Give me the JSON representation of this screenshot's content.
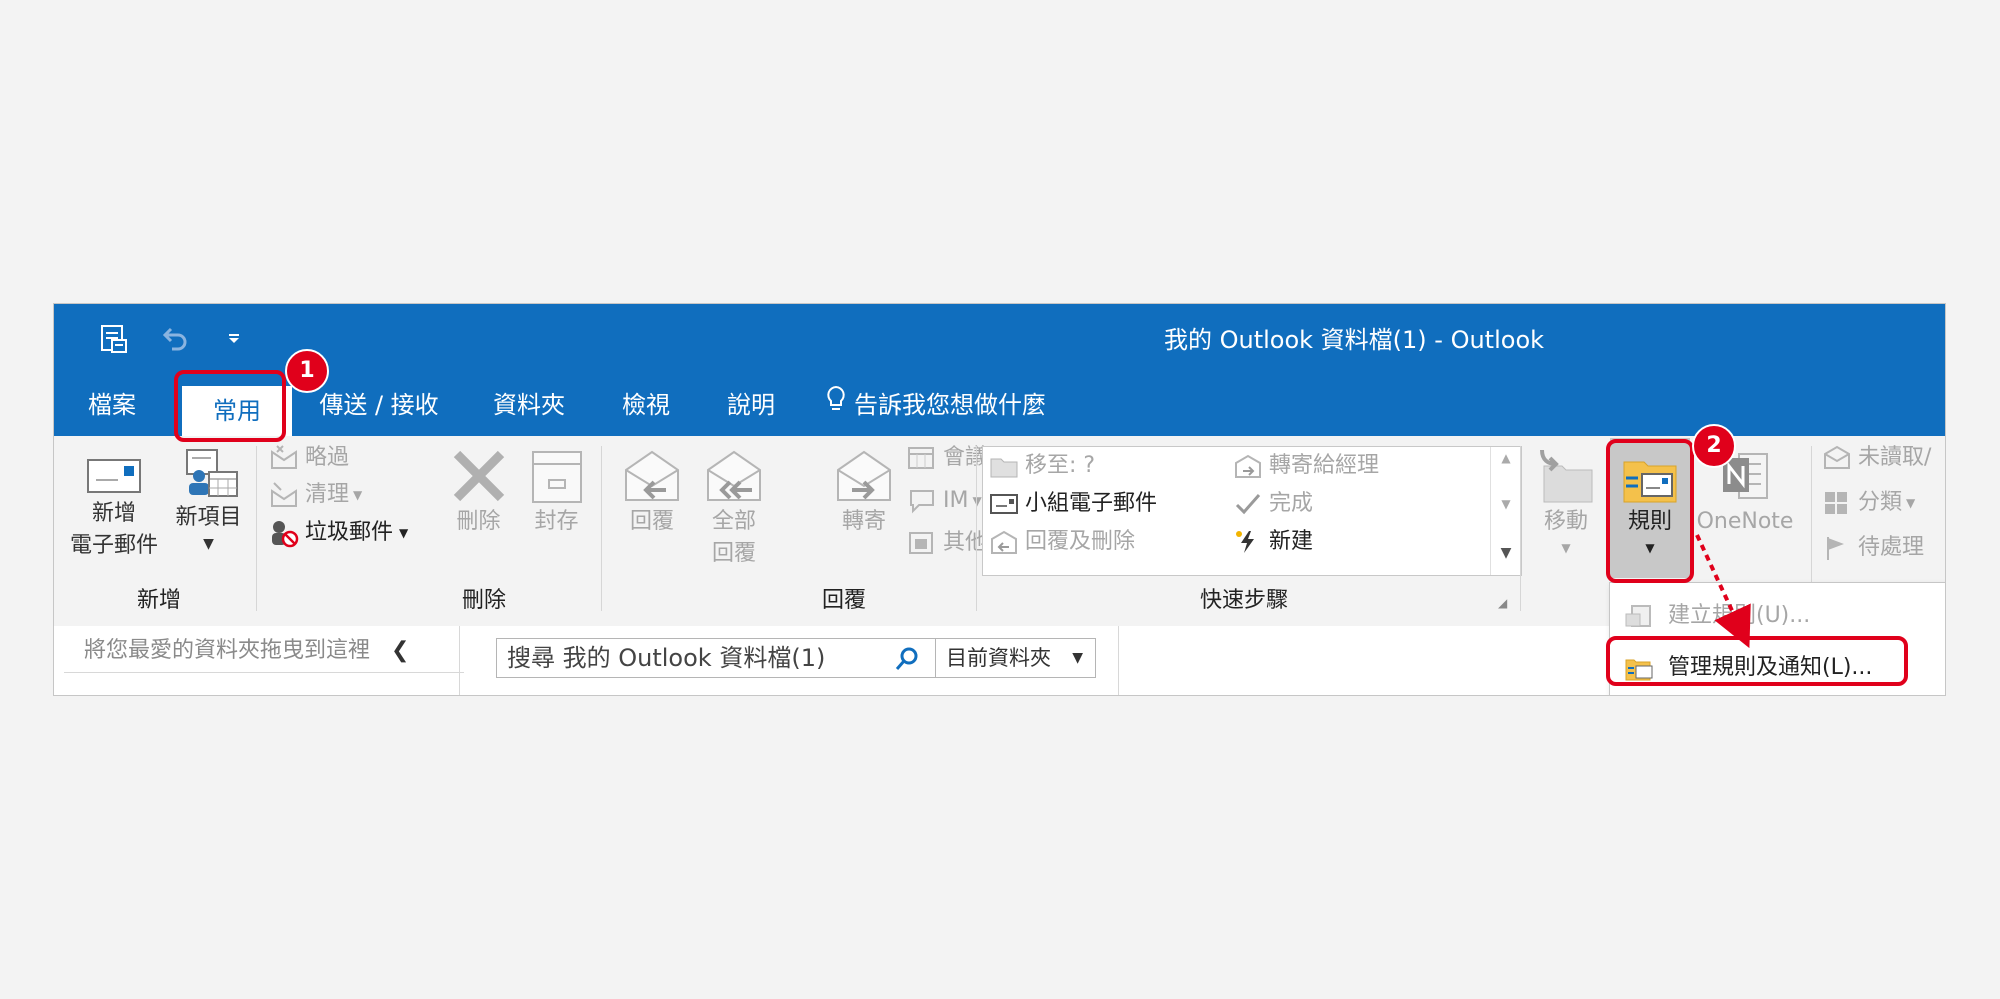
{
  "window": {
    "title": "我的 Outlook 資料檔(1)  -  Outlook"
  },
  "tabs": [
    {
      "label": "檔案"
    },
    {
      "label": "常用"
    },
    {
      "label": "傳送 / 接收"
    },
    {
      "label": "資料夾"
    },
    {
      "label": "檢視"
    },
    {
      "label": "說明"
    },
    {
      "label": "告訴我您想做什麼"
    }
  ],
  "ribbon": {
    "new": {
      "new_email_line1": "新增",
      "new_email_line2": "電子郵件",
      "new_items": "新項目",
      "group_label": "新增"
    },
    "delete": {
      "ignore": "略過",
      "clean_up": "清理",
      "junk": "垃圾郵件",
      "delete": "刪除",
      "archive": "封存",
      "group_label": "刪除"
    },
    "respond": {
      "reply": "回覆",
      "reply_all_line1": "全部",
      "reply_all_line2": "回覆",
      "forward": "轉寄",
      "meeting": "會議",
      "im": "IM",
      "more": "其他",
      "group_label": "回覆"
    },
    "quick_steps": {
      "move_to": "移至: ?",
      "team_email": "小組電子郵件",
      "reply_delete": "回覆及刪除",
      "to_manager": "轉寄給經理",
      "done": "完成",
      "create_new": "新建",
      "group_label": "快速步驟"
    },
    "move": {
      "move": "移動",
      "rules": "規則",
      "onenote": "OneNote"
    },
    "tags": {
      "unread_read": "未讀取/",
      "categorize": "分類",
      "follow_up": "待處理"
    }
  },
  "rules_menu": {
    "create_rule": "建立規則(U)...",
    "manage_rules": "管理規則及通知(L)..."
  },
  "folder_pane": {
    "favorites_hint": "將您最愛的資料夾拖曳到這裡"
  },
  "search": {
    "placeholder": "搜尋 我的 Outlook 資料檔(1)",
    "scope": "目前資料夾"
  },
  "annotations": {
    "step1": "1",
    "step2": "2"
  },
  "colors": {
    "accent": "#106ebe",
    "highlight": "#e0001b",
    "ribbon_bg": "#f3f3f3",
    "disabled_text": "#a6a6a6"
  }
}
